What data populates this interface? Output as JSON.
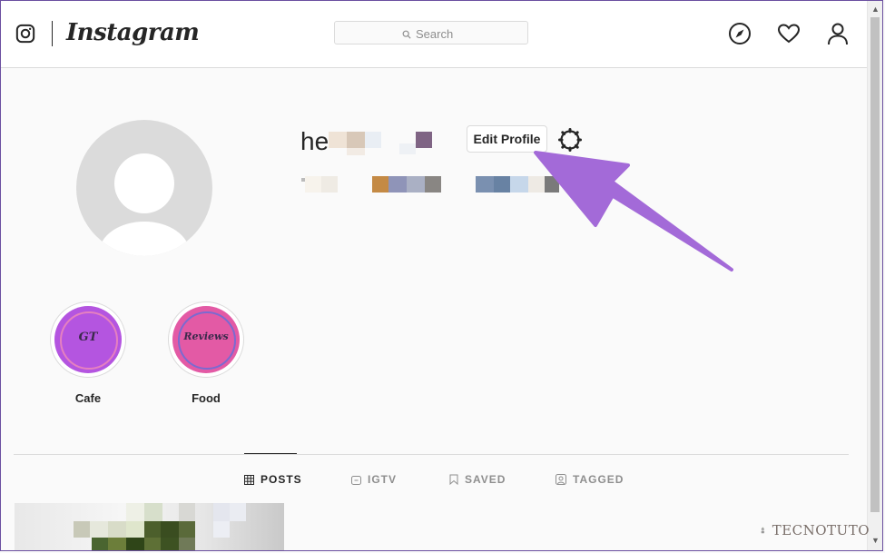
{
  "header": {
    "brand_name": "Instagram",
    "search_placeholder": "Search",
    "icons": [
      "instagram-glyph-icon",
      "compass-icon",
      "heart-icon",
      "profile-icon"
    ]
  },
  "profile": {
    "username_visible": "he",
    "edit_profile_label": "Edit Profile",
    "settings_icon": "gear-icon"
  },
  "highlights": [
    {
      "label": "Cafe",
      "cover_text": "GT",
      "color": "#b455e0"
    },
    {
      "label": "Food",
      "cover_text": "Reviews",
      "color": "#e35aa5"
    }
  ],
  "tabs": [
    {
      "label": "POSTS",
      "icon": "grid-icon",
      "active": true
    },
    {
      "label": "IGTV",
      "icon": "igtv-icon",
      "active": false
    },
    {
      "label": "SAVED",
      "icon": "bookmark-icon",
      "active": false
    },
    {
      "label": "TAGGED",
      "icon": "tag-icon",
      "active": false
    }
  ],
  "annotation": {
    "color": "#a36ad8"
  },
  "watermark": {
    "text": "TECNOTUTO"
  }
}
